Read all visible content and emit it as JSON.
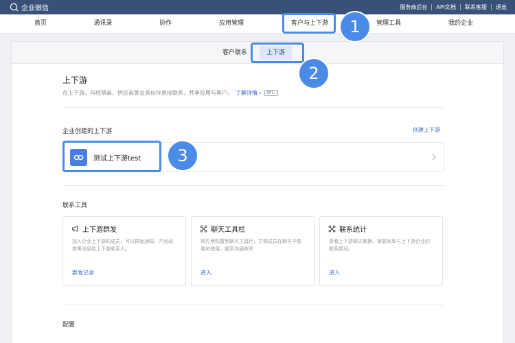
{
  "topbar": {
    "brand": "企业微信",
    "links": [
      "服务商后台",
      "API文档",
      "联系客服",
      "退出"
    ]
  },
  "nav": {
    "items": [
      {
        "label": "首页"
      },
      {
        "label": "通讯录"
      },
      {
        "label": "协作"
      },
      {
        "label": "应用管理"
      },
      {
        "label": "客户与上下游"
      },
      {
        "label": "管理工具"
      },
      {
        "label": "我的企业"
      }
    ]
  },
  "subnav": {
    "tabs": [
      {
        "label": "客户联系"
      },
      {
        "label": "上下游"
      }
    ]
  },
  "page": {
    "title": "上下游",
    "description": "在上下游，与经销商、供应商等业务伙伴直接联系，共享应用与客户。",
    "more_link": "了解详情",
    "api_tag": "API"
  },
  "chains": {
    "section_title": "企业创建的上下游",
    "create_link": "创建上下游",
    "items": [
      {
        "name": "测试上下游test"
      }
    ]
  },
  "tools": {
    "section_title": "联系工具",
    "cards": [
      {
        "title": "上下游群发",
        "desc": "加入企业上下游的成员，可以群发通知、产品动态等消息给上下游联系人。",
        "link": "群发记录",
        "icon": "megaphone-icon"
      },
      {
        "title": "聊天工具栏",
        "desc": "将应用配置到聊天工具栏，方便成员在聊天中查看和使用，提高沟通效率",
        "link": "进入",
        "icon": "toolbar-icon"
      },
      {
        "title": "联系统计",
        "desc": "查看上下游聊天数据，掌握同事与上下游企业的联系情况。",
        "link": "进入",
        "icon": "stats-icon"
      }
    ]
  },
  "config": {
    "section_title": "配置"
  },
  "annotations": [
    "1",
    "2",
    "3"
  ],
  "colors": {
    "topbar": "#3a5177",
    "accent": "#4a8be8",
    "link": "#3a6bc8"
  }
}
